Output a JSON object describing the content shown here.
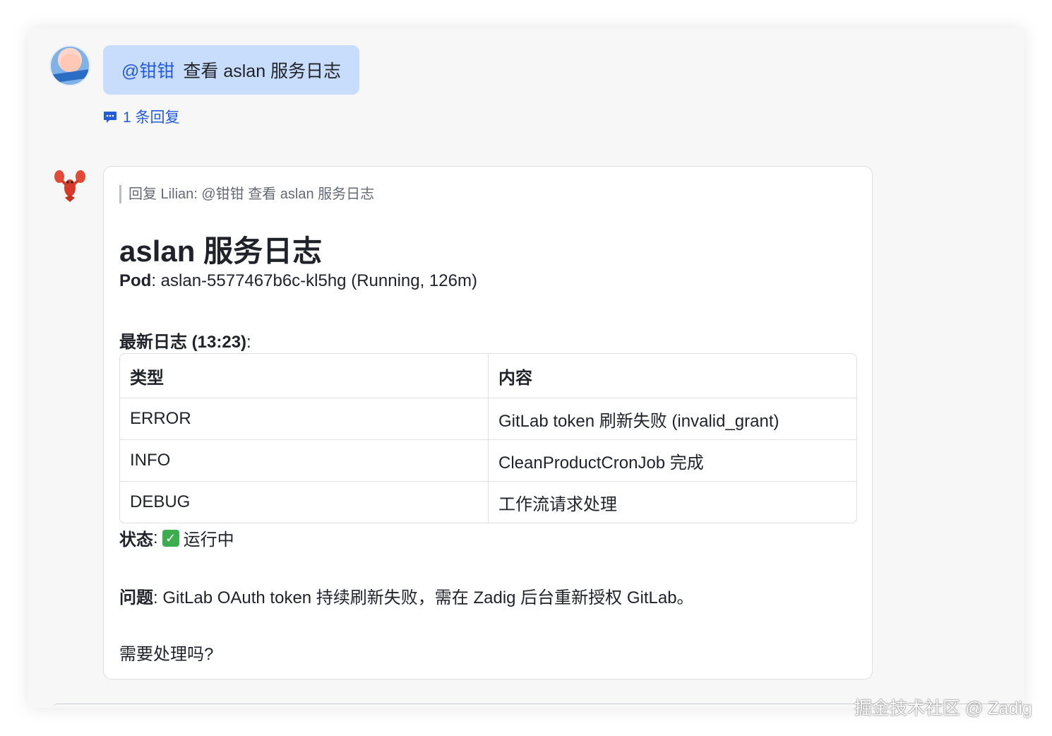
{
  "message_user": {
    "mention": "@钳钳",
    "text": "查看 aslan 服务日志",
    "reply_count_label": "1 条回复"
  },
  "message_bot": {
    "quote": "回复 Lilian:  @钳钳 查看 aslan 服务日志",
    "title": "aslan 服务日志",
    "pod_label": "Pod",
    "pod_value": ": aslan-5577467b6c-kl5hg (Running, 126m)",
    "logs_label": "最新日志 (13:23)",
    "logs_suffix": ":",
    "table": {
      "headers": [
        "类型",
        "内容"
      ],
      "rows": [
        [
          "ERROR",
          "GitLab token 刷新失败 (invalid_grant)"
        ],
        [
          "INFO",
          "CleanProductCronJob 完成"
        ],
        [
          "DEBUG",
          "工作流请求处理"
        ]
      ]
    },
    "status_label": "状态",
    "status_sep": ":",
    "status_value": "运行中",
    "issue_label": "问题",
    "issue_value": ": GitLab OAuth token 持续刷新失败，需在 Zadig 后台重新授权 GitLab。",
    "question": "需要处理吗?"
  },
  "watermark": "掘金技术社区 @ Zadig",
  "icons": {
    "reply": "comment-icon",
    "check": "check-mark-icon",
    "bot_avatar": "lobster-icon"
  }
}
